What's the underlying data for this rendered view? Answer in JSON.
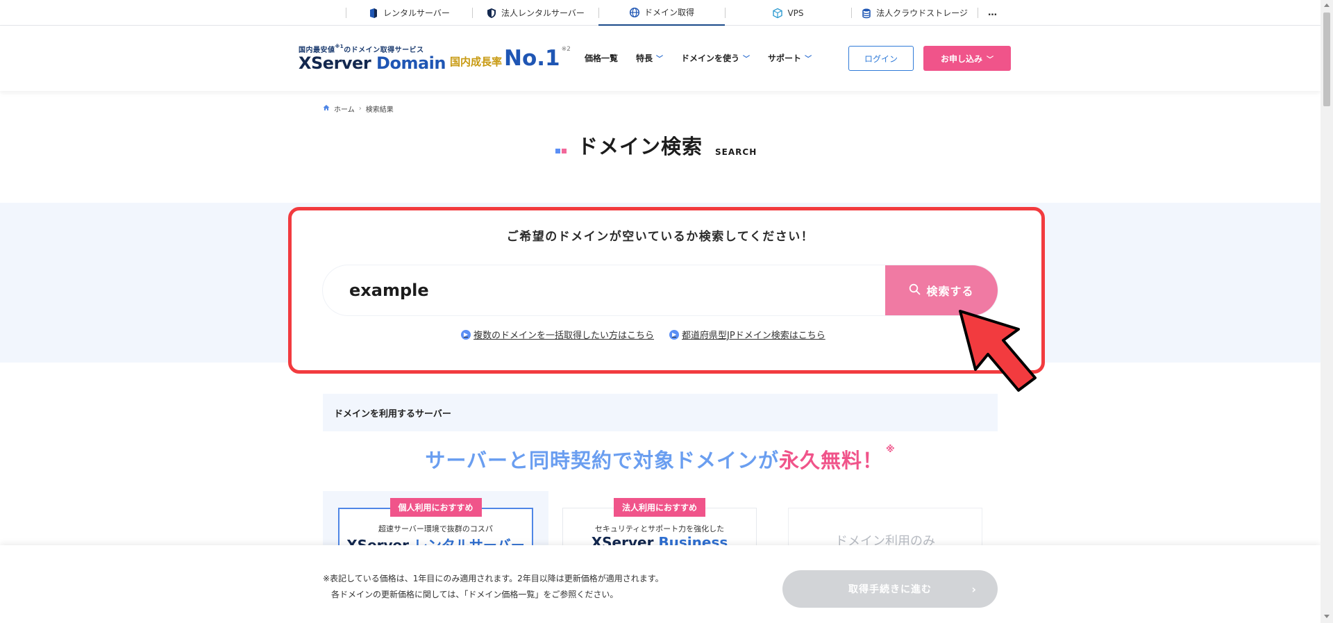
{
  "service_bar": {
    "items": [
      {
        "label": "レンタルサーバー",
        "icon": "rental-server-icon"
      },
      {
        "label": "法人レンタルサーバー",
        "icon": "shield-icon"
      },
      {
        "label": "ドメイン取得",
        "icon": "globe-icon",
        "active": true
      },
      {
        "label": "VPS",
        "icon": "cube-icon"
      },
      {
        "label": "法人クラウドストレージ",
        "icon": "database-icon"
      }
    ],
    "more_label": "…"
  },
  "header": {
    "logo_sub": "国内最安値",
    "logo_sub_note": "※1",
    "logo_sub_rest": "のドメイン取得サービス",
    "logo_main_x": "XServer",
    "logo_main_domain": "Domain",
    "no1_text": "国内成長率",
    "no1_big": "No.1",
    "no1_note": "※2",
    "nav": [
      {
        "label": "価格一覧",
        "dropdown": false
      },
      {
        "label": "特長",
        "dropdown": true
      },
      {
        "label": "ドメインを使う",
        "dropdown": true
      },
      {
        "label": "サポート",
        "dropdown": true
      }
    ],
    "login_label": "ログイン",
    "apply_label": "お申し込み"
  },
  "breadcrumb": {
    "home": "ホーム",
    "current": "検索結果"
  },
  "page": {
    "title": "ドメイン検索",
    "title_en": "SEARCH"
  },
  "search": {
    "lead": "ご希望のドメインが空いているか検索してください！",
    "value": "example",
    "button_label": "検索する",
    "links": [
      "複数のドメインを一括取得したい方はこちら",
      "都道府県型JPドメイン検索はこちら"
    ]
  },
  "servers": {
    "heading": "ドメインを利用するサーバー",
    "promo_main": "サーバーと同時契約で対象ドメインが",
    "promo_pink": "永久無料！",
    "promo_note": "※",
    "cards": [
      {
        "badge": "個人利用におすすめ",
        "sub": "超速サーバー環境で抜群のコスパ",
        "name_a": "XServer",
        "name_b": "レンタルサーバー"
      },
      {
        "badge": "法人利用におすすめ",
        "sub": "セキュリティとサポート力を強化した",
        "name_a": "XServer",
        "name_b": "Business"
      },
      {
        "only": "ドメイン利用のみ"
      }
    ]
  },
  "footer": {
    "note_line1": "※表記している価格は、1年目にのみ適用されます。2年目以降は更新価格が適用されます。",
    "note_line2": "各ドメインの更新価格に関しては、「ドメイン価格一覧」をご参照ください。",
    "proceed_label": "取得手続きに進む"
  },
  "colors": {
    "brand_navy": "#13284f",
    "brand_blue": "#2f6fd0",
    "pink": "#f0548a",
    "highlight_red": "#f23b3f",
    "disabled_gray": "#d2d4d7"
  }
}
